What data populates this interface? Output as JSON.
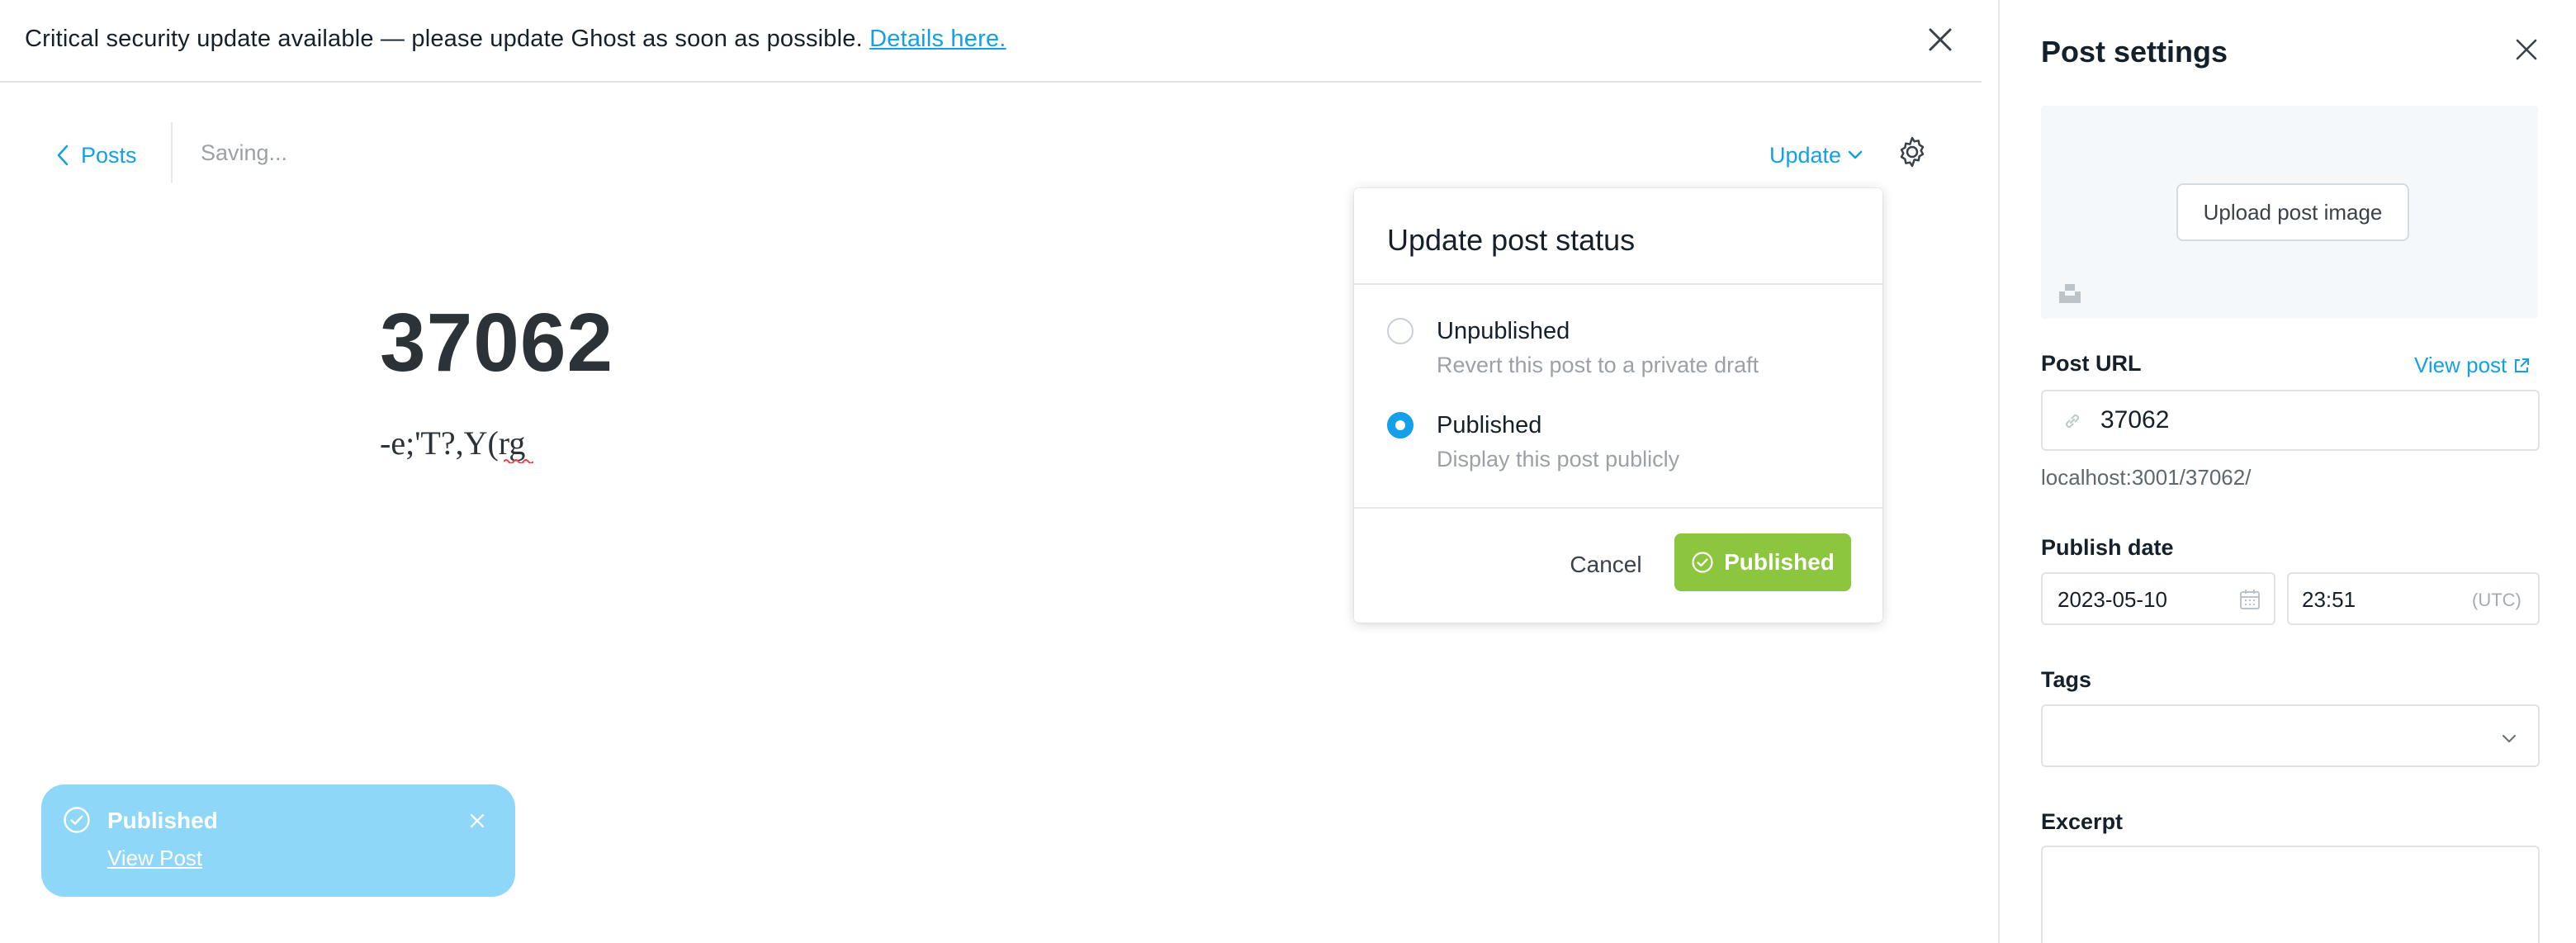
{
  "alert": {
    "message": "Critical security update available — please update Ghost as soon as possible.",
    "link_text": "Details here."
  },
  "nav": {
    "back_label": "Posts",
    "save_status": "Saving...",
    "update_label": "Update"
  },
  "post": {
    "title": "37062",
    "body": "-e;'T?,Y(rg"
  },
  "status_popover": {
    "title": "Update post status",
    "options": [
      {
        "label": "Unpublished",
        "description": "Revert this post to a private draft",
        "selected": false
      },
      {
        "label": "Published",
        "description": "Display this post publicly",
        "selected": true
      }
    ],
    "cancel_label": "Cancel",
    "confirm_label": "Published"
  },
  "toast": {
    "title": "Published",
    "link_text": "View Post"
  },
  "settings": {
    "title": "Post settings",
    "upload_label": "Upload post image",
    "url_label": "Post URL",
    "view_post_label": "View post",
    "url_value": "37062",
    "url_preview": "localhost:3001/37062/",
    "publish_date_label": "Publish date",
    "date_value": "2023-05-10",
    "time_value": "23:51",
    "timezone": "(UTC)",
    "tags_label": "Tags",
    "excerpt_label": "Excerpt"
  },
  "colors": {
    "accent": "#14a0e8",
    "publish_green": "#8cc63f",
    "toast_blue": "#8ed7f8"
  },
  "icons": [
    "close-icon",
    "chevron-left-icon",
    "chevron-down-icon",
    "gear-icon",
    "check-circle-icon",
    "link-icon",
    "external-link-icon",
    "calendar-icon",
    "unsplash-icon"
  ]
}
